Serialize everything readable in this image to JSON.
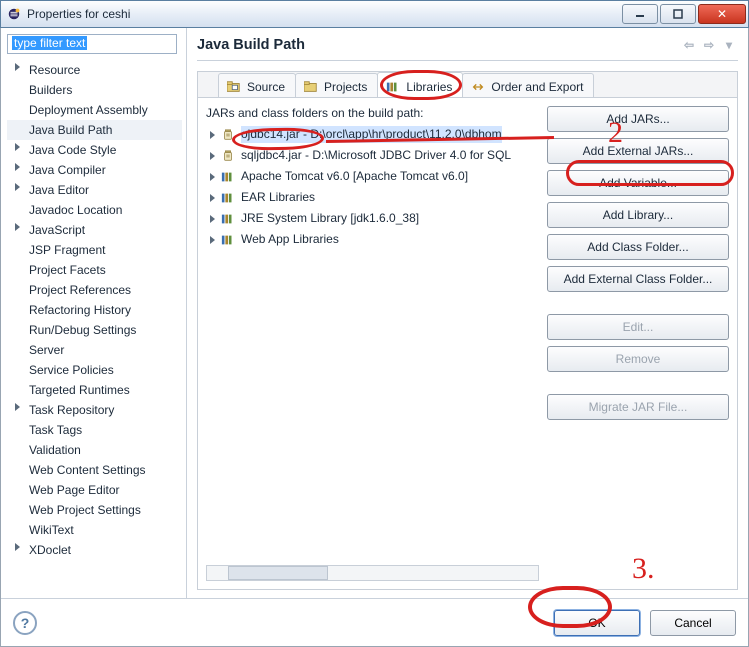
{
  "window": {
    "title": "Properties for ceshi"
  },
  "filter": {
    "placeholder": "type filter text"
  },
  "nav": {
    "items": [
      {
        "label": "Resource",
        "expandable": true
      },
      {
        "label": "Builders"
      },
      {
        "label": "Deployment Assembly"
      },
      {
        "label": "Java Build Path",
        "selected": true
      },
      {
        "label": "Java Code Style",
        "expandable": true
      },
      {
        "label": "Java Compiler",
        "expandable": true
      },
      {
        "label": "Java Editor",
        "expandable": true
      },
      {
        "label": "Javadoc Location"
      },
      {
        "label": "JavaScript",
        "expandable": true
      },
      {
        "label": "JSP Fragment"
      },
      {
        "label": "Project Facets"
      },
      {
        "label": "Project References"
      },
      {
        "label": "Refactoring History"
      },
      {
        "label": "Run/Debug Settings"
      },
      {
        "label": "Server"
      },
      {
        "label": "Service Policies"
      },
      {
        "label": "Targeted Runtimes"
      },
      {
        "label": "Task Repository",
        "expandable": true
      },
      {
        "label": "Task Tags"
      },
      {
        "label": "Validation"
      },
      {
        "label": "Web Content Settings"
      },
      {
        "label": "Web Page Editor"
      },
      {
        "label": "Web Project Settings"
      },
      {
        "label": "WikiText"
      },
      {
        "label": "XDoclet",
        "expandable": true
      }
    ]
  },
  "page": {
    "heading": "Java Build Path",
    "tabs": [
      {
        "id": "source",
        "label": "Source",
        "icon": "source"
      },
      {
        "id": "projects",
        "label": "Projects",
        "icon": "projects"
      },
      {
        "id": "libraries",
        "label": "Libraries",
        "icon": "libraries",
        "active": true
      },
      {
        "id": "order",
        "label": "Order and Export",
        "icon": "order"
      }
    ],
    "list_label": "JARs and class folders on the build path:",
    "entries": [
      {
        "icon": "jar",
        "label": "ojdbc14.jar - D:\\orcl\\app\\hr\\product\\11.2.0\\dbhom",
        "selected": true
      },
      {
        "icon": "jar",
        "label": "sqljdbc4.jar - D:\\Microsoft JDBC Driver 4.0 for SQL"
      },
      {
        "icon": "lib",
        "label": "Apache Tomcat v6.0 [Apache Tomcat v6.0]"
      },
      {
        "icon": "lib",
        "label": "EAR Libraries"
      },
      {
        "icon": "lib",
        "label": "JRE System Library [jdk1.6.0_38]"
      },
      {
        "icon": "lib",
        "label": "Web App Libraries"
      }
    ],
    "buttons": {
      "add_jars": "Add JARs...",
      "add_ext_jars": "Add External JARs...",
      "add_var": "Add Variable...",
      "add_lib": "Add Library...",
      "add_cf": "Add Class Folder...",
      "add_ext_cf": "Add External Class Folder...",
      "edit": "Edit...",
      "remove": "Remove",
      "migrate": "Migrate JAR File..."
    }
  },
  "bottom": {
    "ok": "OK",
    "cancel": "Cancel"
  },
  "annotations": {
    "n2": "2",
    "n3": "3."
  }
}
